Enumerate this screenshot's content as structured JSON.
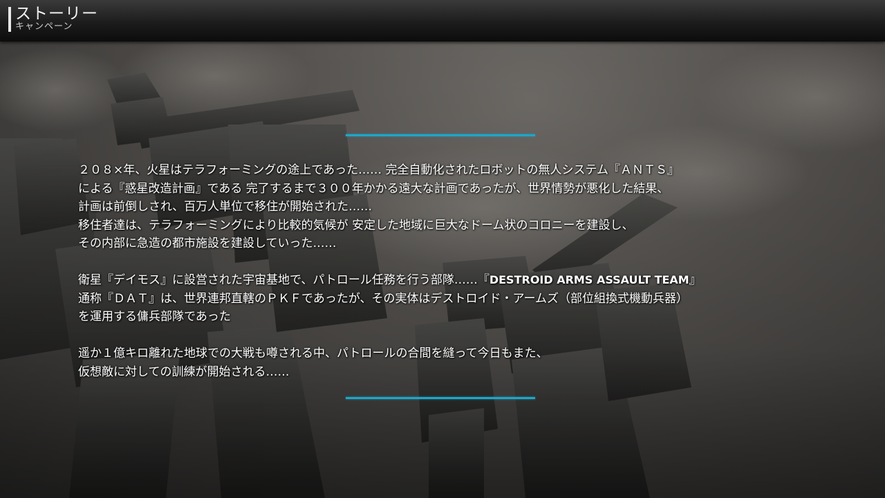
{
  "header": {
    "title": "ストーリー",
    "subtitle": "キャンペーン"
  },
  "colors": {
    "accent_line": "#1fa6c9",
    "header_bar": "#1c1c1c",
    "text": "#ffffff"
  },
  "story": {
    "paragraph1": [
      "２０８×年、火星はテラフォーミングの途上であった…… 完全自動化されたロボットの無人システム『ＡＮＴＳ』",
      "による『惑星改造計画』である 完了するまで３００年かかる遠大な計画であったが、世界情勢が悪化した結果、",
      "計画は前倒しされ、百万人単位で移住が開始された……",
      "移住者達は、テラフォーミングにより比較的気候が 安定した地域に巨大なドーム状のコロニーを建設し、",
      "その内部に急造の都市施設を建設していった……"
    ],
    "paragraph2": {
      "line1_prefix": "衛星『デイモス』に設営された宇宙基地で、パトロール任務を行う部隊……『",
      "line1_team": "DESTROID ARMS ASSAULT TEAM",
      "line1_suffix": "』",
      "line2": "通称『ＤＡＴ』は、世界連邦直轄のＰＫＦであったが、その実体はデストロイド・アームズ（部位組換式機動兵器）",
      "line3": "を運用する傭兵部隊であった"
    },
    "paragraph3": [
      "遥か１億キロ離れた地球での大戦も噂される中、パトロールの合間を縫って今日もまた、",
      "仮想敵に対しての訓練が開始される……"
    ]
  }
}
